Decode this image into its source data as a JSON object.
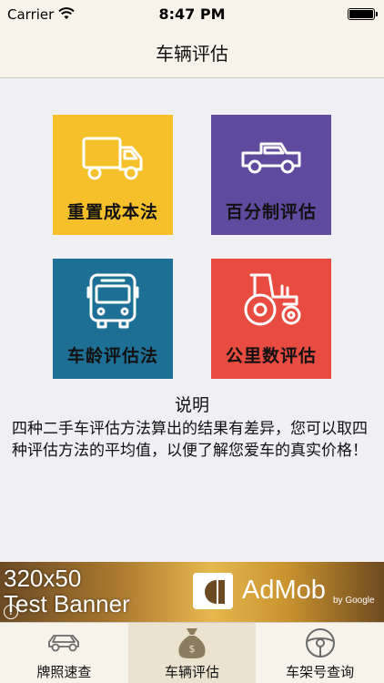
{
  "status_bar": {
    "carrier": "Carrier",
    "time": "8:47 PM"
  },
  "nav": {
    "title": "车辆评估"
  },
  "tiles": [
    {
      "label": "重置成本法",
      "icon": "truck-icon",
      "color": "#f5c02a"
    },
    {
      "label": "百分制评估",
      "icon": "pickup-truck-icon",
      "color": "#5f4a9d"
    },
    {
      "label": "车龄评估法",
      "icon": "bus-icon",
      "color": "#1e6f96"
    },
    {
      "label": "公里数评估",
      "icon": "tractor-icon",
      "color": "#e84c41"
    }
  ],
  "info": {
    "title": "说明",
    "body": "四种二手车评估方法算出的结果有差异，您可以取四种评估方法的平均值，以便了解您爱车的真实价格！"
  },
  "banner": {
    "line1": "320x50",
    "line2": "Test Banner",
    "brand": "AdMob",
    "brand_sub": "by Google",
    "info_badge": "i"
  },
  "tabbar": {
    "items": [
      {
        "label": "牌照速查",
        "icon": "car-icon",
        "active": false
      },
      {
        "label": "车辆评估",
        "icon": "money-bag-icon",
        "active": true
      },
      {
        "label": "车架号查询",
        "icon": "steering-wheel-icon",
        "active": false
      }
    ]
  }
}
